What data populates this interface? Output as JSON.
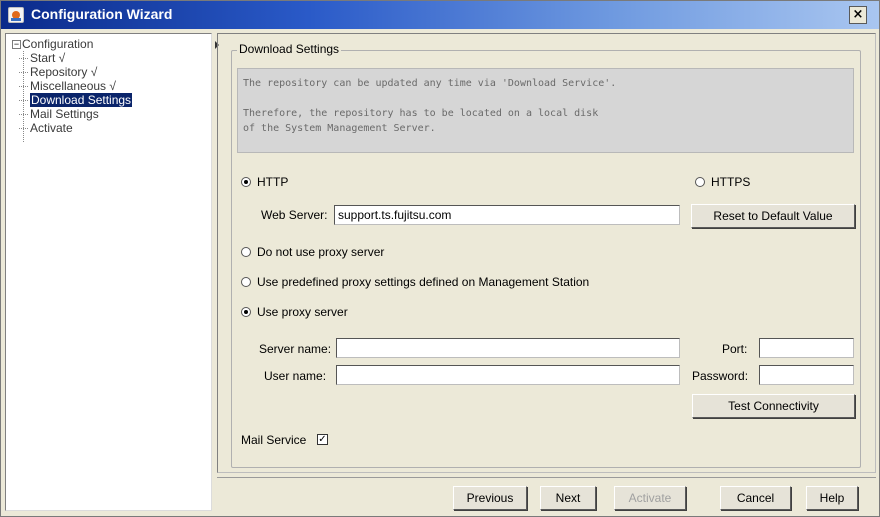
{
  "window": {
    "title": "Configuration Wizard",
    "close_glyph": "×"
  },
  "tree": {
    "root_toggle": "−",
    "root_label": "Configuration",
    "items": [
      {
        "label": "Start √"
      },
      {
        "label": "Repository √"
      },
      {
        "label": "Miscellaneous √"
      },
      {
        "label": "Download Settings",
        "selected": true
      },
      {
        "label": "Mail Settings"
      },
      {
        "label": "Activate"
      }
    ]
  },
  "panel": {
    "legend": "Download Settings",
    "info_text": "The repository can be updated any time via 'Download Service'.\n\nTherefore, the repository has to be located on a local disk\nof the System Management Server.",
    "protocol": {
      "http_label": "HTTP",
      "http_selected": true,
      "https_label": "HTTPS",
      "https_selected": false
    },
    "web_server": {
      "label": "Web Server:",
      "value": "support.ts.fujitsu.com"
    },
    "reset_button": "Reset to Default Value",
    "proxy": {
      "option_none": "Do not use proxy server",
      "option_predefined": "Use predefined proxy settings defined on Management Station",
      "option_custom": "Use proxy server",
      "selected": "custom"
    },
    "server_name": {
      "label": "Server name:",
      "value": ""
    },
    "port": {
      "label": "Port:",
      "value": ""
    },
    "user_name": {
      "label": "User name:",
      "value": ""
    },
    "password": {
      "label": "Password:",
      "value": ""
    },
    "test_button": "Test Connectivity",
    "mail_service": {
      "label": "Mail Service",
      "checked": true,
      "check_glyph": "✓"
    }
  },
  "footer": {
    "previous": "Previous",
    "next": "Next",
    "activate": "Activate",
    "cancel": "Cancel",
    "help": "Help"
  }
}
